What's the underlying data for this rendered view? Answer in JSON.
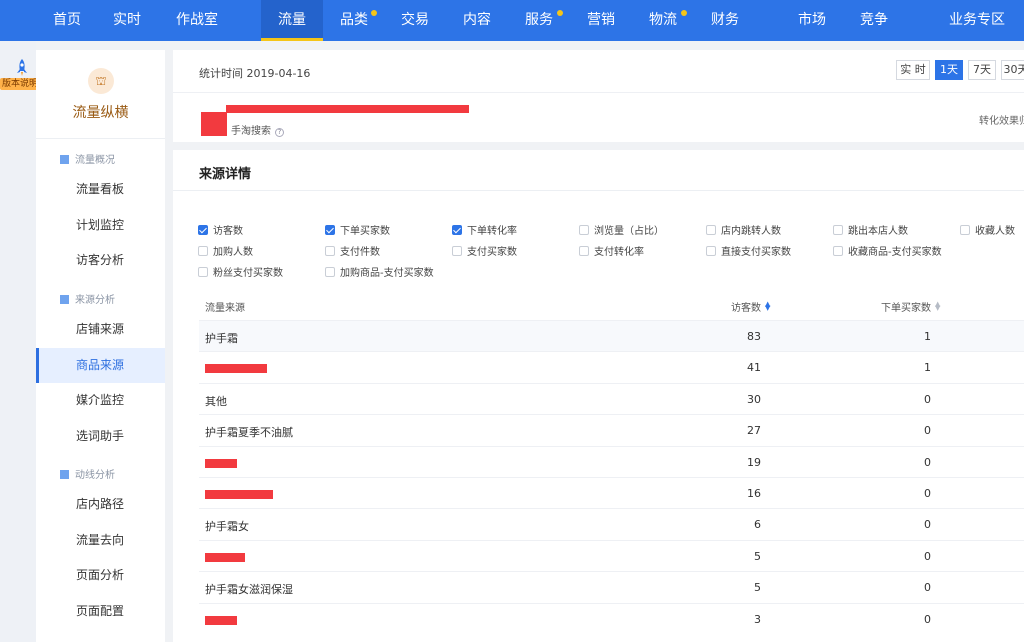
{
  "nav": {
    "items": [
      {
        "label": "首页"
      },
      {
        "label": "实时"
      },
      {
        "label": "作战室"
      },
      {
        "label": "流量"
      },
      {
        "label": "品类"
      },
      {
        "label": "交易"
      },
      {
        "label": "内容"
      },
      {
        "label": "服务"
      },
      {
        "label": "营销"
      },
      {
        "label": "物流"
      },
      {
        "label": "财务"
      },
      {
        "label": "市场"
      },
      {
        "label": "竞争"
      },
      {
        "label": "业务专区"
      }
    ],
    "active": "流量"
  },
  "strip": {
    "version_label": "版本说明"
  },
  "sidebar": {
    "logo_icon": "chart-icon",
    "title": "流量纵横",
    "groups": [
      {
        "label": "流量概况",
        "items": [
          "流量看板",
          "计划监控",
          "访客分析"
        ]
      },
      {
        "label": "来源分析",
        "items": [
          "店铺来源",
          "商品来源",
          "媒介监控",
          "选词助手"
        ]
      },
      {
        "label": "动线分析",
        "items": [
          "店内路径",
          "流量去向",
          "页面分析",
          "页面配置"
        ]
      }
    ],
    "active_item": "商品来源"
  },
  "stats": {
    "time_label": "统计时间 2019-04-16",
    "ranges": [
      "实 时",
      "1天",
      "7天",
      "30天"
    ],
    "active_range": "1天"
  },
  "product": {
    "sub_label": "手淘搜索",
    "conversion_label": "转化效果归"
  },
  "source_detail": {
    "title": "来源详情",
    "metrics": [
      {
        "label": "访客数",
        "checked": true
      },
      {
        "label": "下单买家数",
        "checked": true
      },
      {
        "label": "下单转化率",
        "checked": true
      },
      {
        "label": "浏览量（占比）",
        "checked": false
      },
      {
        "label": "店内跳转人数",
        "checked": false
      },
      {
        "label": "跳出本店人数",
        "checked": false
      },
      {
        "label": "收藏人数",
        "checked": false
      },
      {
        "label": "加购人数",
        "checked": false
      },
      {
        "label": "支付件数",
        "checked": false
      },
      {
        "label": "支付买家数",
        "checked": false
      },
      {
        "label": "支付转化率",
        "checked": false
      },
      {
        "label": "直接支付买家数",
        "checked": false
      },
      {
        "label": "收藏商品-支付买家数",
        "checked": false
      },
      {
        "label": "粉丝支付买家数",
        "checked": false
      },
      {
        "label": "加购商品-支付买家数",
        "checked": false
      }
    ],
    "columns": {
      "source": "流量来源",
      "visitors": "访客数",
      "buyers": "下单买家数"
    },
    "rows": [
      {
        "source": "护手霜",
        "visitors": "83",
        "buyers": "1",
        "redacted": false
      },
      {
        "source": "",
        "visitors": "41",
        "buyers": "1",
        "redacted": true
      },
      {
        "source": "其他",
        "visitors": "30",
        "buyers": "0",
        "redacted": false
      },
      {
        "source": "护手霜夏季不油腻",
        "visitors": "27",
        "buyers": "0",
        "redacted": false
      },
      {
        "source": "",
        "visitors": "19",
        "buyers": "0",
        "redacted": true
      },
      {
        "source": "",
        "visitors": "16",
        "buyers": "0",
        "redacted": true
      },
      {
        "source": "护手霜女",
        "visitors": "6",
        "buyers": "0",
        "redacted": false
      },
      {
        "source": "",
        "visitors": "5",
        "buyers": "0",
        "redacted": true
      },
      {
        "source": "护手霜女滋润保湿",
        "visitors": "5",
        "buyers": "0",
        "redacted": false
      },
      {
        "source": "",
        "visitors": "3",
        "buyers": "0",
        "redacted": true
      }
    ]
  }
}
